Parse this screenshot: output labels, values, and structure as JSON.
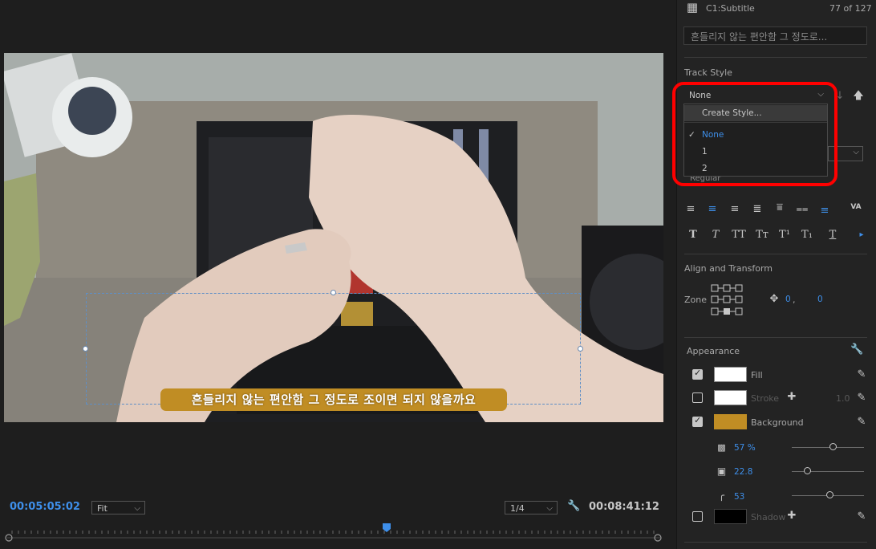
{
  "monitor": {
    "subtitle_text": "흔들리지 않는 편안함 그 정도로 조이면 되지 않을까요",
    "timecode_current": "00:05:05:02",
    "timecode_duration": "00:08:41:12",
    "zoom": "Fit",
    "resolution": "1/4"
  },
  "panel": {
    "caption_track": "C1:Subtitle",
    "caption_counter": "77 of 127",
    "caption_text_field": "흔들리지 않는 편안함 그 정도로...",
    "track_style_heading": "Track Style",
    "track_style_value": "None",
    "track_style_menu": {
      "create": "Create Style...",
      "options": [
        "None",
        "1",
        "2"
      ],
      "selected": "None"
    },
    "font_style_partial": "Regular",
    "align_transform_heading": "Align and Transform",
    "zone_label": "Zone",
    "position_x": "0",
    "position_y": "0",
    "appearance_heading": "Appearance",
    "fill": {
      "label": "Fill",
      "checked": true,
      "color": "#ffffff"
    },
    "stroke": {
      "label": "Stroke",
      "checked": false,
      "color": "#ffffff",
      "width": "1.0"
    },
    "background": {
      "label": "Background",
      "checked": true,
      "color": "#c08d24",
      "opacity": "57 %",
      "size": "22.8",
      "corner": "53"
    },
    "shadow": {
      "label": "Shadow",
      "checked": false,
      "color": "#000000"
    }
  },
  "colors": {
    "accent": "#3e8fea",
    "highlight_red": "#ff0000"
  }
}
